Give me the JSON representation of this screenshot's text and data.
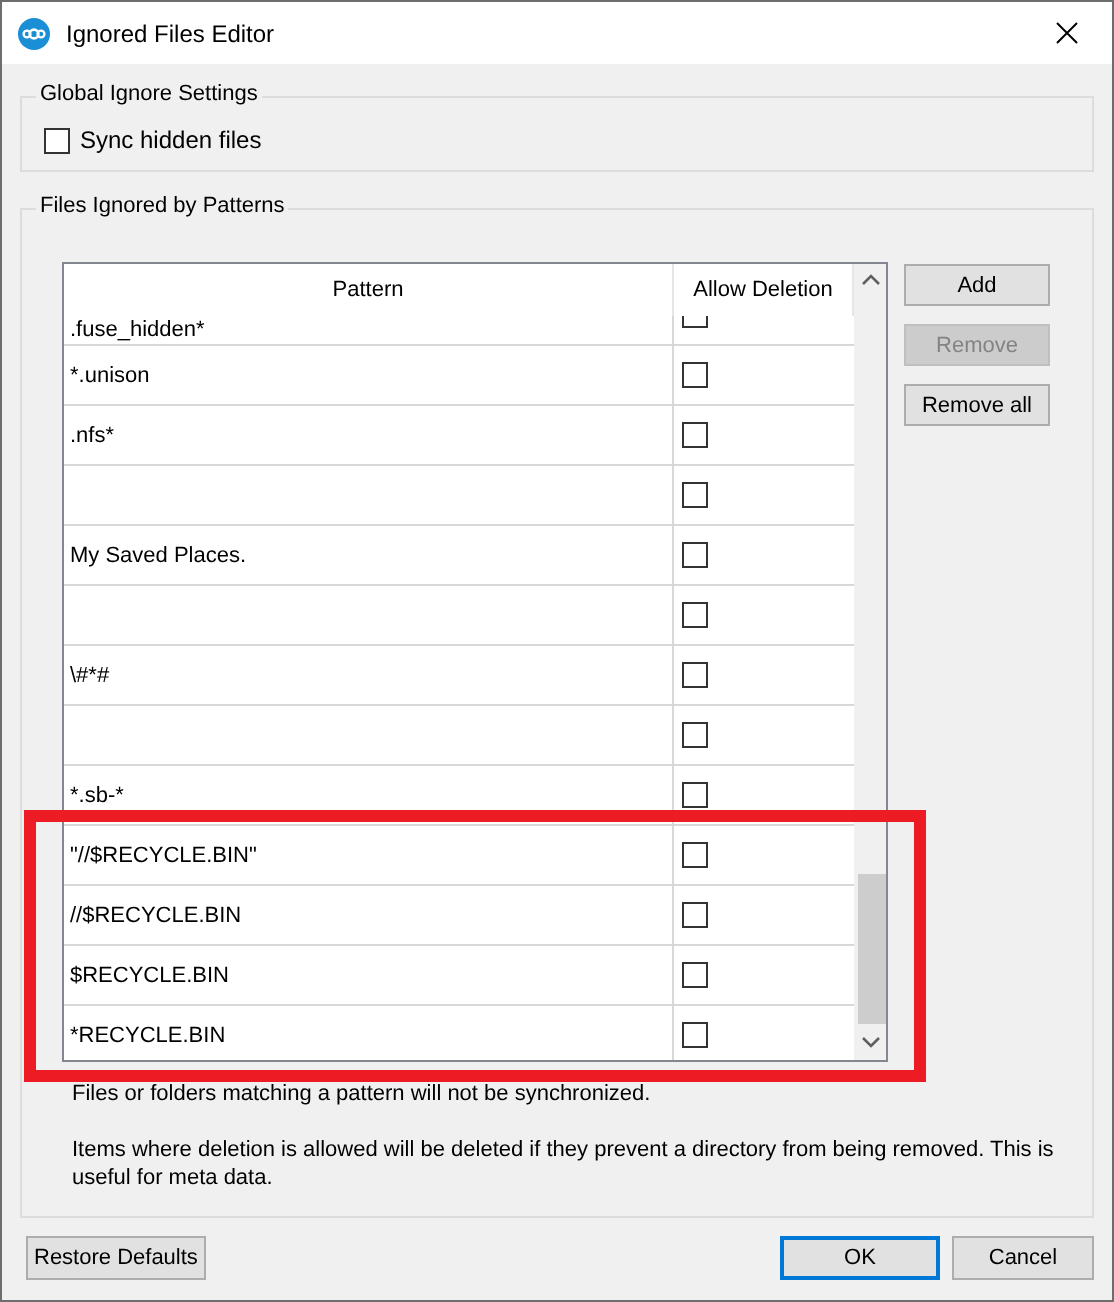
{
  "window": {
    "title": "Ignored Files Editor"
  },
  "global_group": {
    "title": "Global Ignore Settings",
    "sync_hidden": {
      "label": "Sync hidden files",
      "checked": false
    }
  },
  "patterns_group": {
    "title": "Files Ignored by Patterns",
    "columns": [
      "Pattern",
      "Allow Deletion"
    ],
    "rows": [
      {
        "pattern": ".fuse_hidden*",
        "allow_deletion": false,
        "highlighted": false
      },
      {
        "pattern": "*.unison",
        "allow_deletion": false,
        "highlighted": false
      },
      {
        "pattern": ".nfs*",
        "allow_deletion": false,
        "highlighted": false
      },
      {
        "allow_deletion": false,
        "highlighted": false
      },
      {
        "pattern": "My Saved Places.",
        "allow_deletion": false,
        "highlighted": false
      },
      {
        "allow_deletion": false,
        "highlighted": false
      },
      {
        "pattern": "\\#*#",
        "allow_deletion": false,
        "highlighted": false
      },
      {
        "allow_deletion": false,
        "highlighted": false
      },
      {
        "pattern": "*.sb-*",
        "allow_deletion": false,
        "highlighted": false
      },
      {
        "pattern": "\"//$RECYCLE.BIN\"",
        "allow_deletion": false,
        "highlighted": true
      },
      {
        "pattern": "//$RECYCLE.BIN",
        "allow_deletion": false,
        "highlighted": true
      },
      {
        "pattern": "$RECYCLE.BIN",
        "allow_deletion": false,
        "highlighted": true
      },
      {
        "pattern": "*RECYCLE.BIN",
        "allow_deletion": false,
        "highlighted": true
      }
    ],
    "buttons": [
      {
        "label": "Add",
        "disabled": false
      },
      {
        "label": "Remove",
        "disabled": true
      },
      {
        "label": "Remove all",
        "disabled": false
      }
    ],
    "notes": [
      "Files or folders matching a pattern will not be synchronized.",
      "Items where deletion is allowed will be deleted if they prevent a directory from being removed. This is useful for meta data."
    ]
  },
  "footer": {
    "restore": {
      "label": "Restore Defaults"
    },
    "buttons": [
      {
        "label": "OK",
        "default": true
      },
      {
        "label": "Cancel",
        "default": false
      }
    ]
  }
}
